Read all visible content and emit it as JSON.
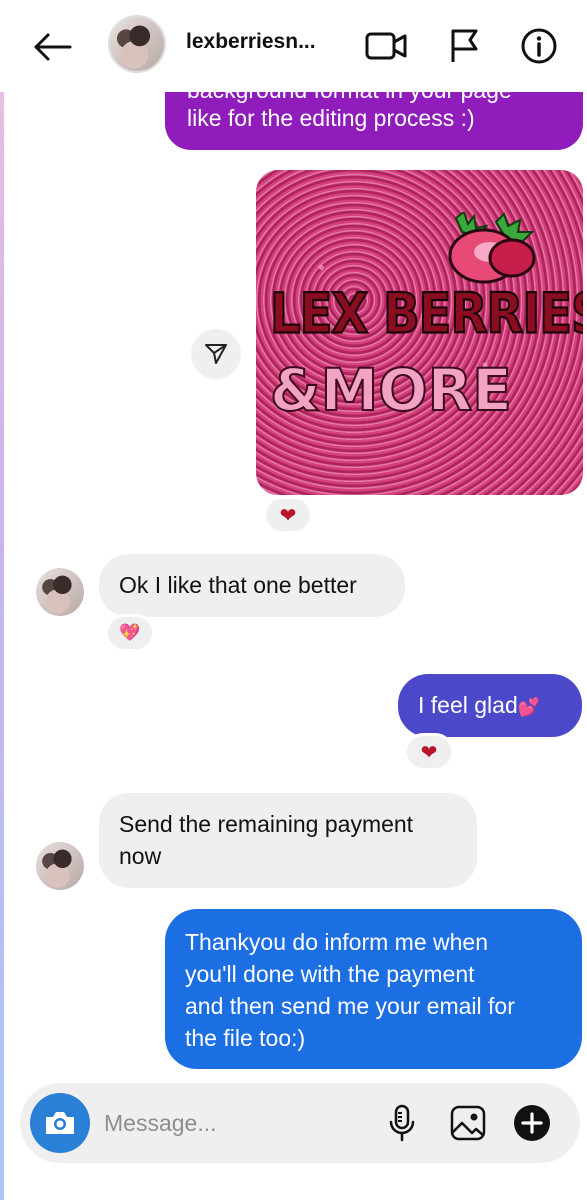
{
  "header": {
    "username": "lexberriesn...",
    "icons": [
      "back-arrow-icon",
      "video-call-icon",
      "flag-icon",
      "info-icon"
    ]
  },
  "messages": [
    {
      "from": "me",
      "text_cut": "background format in your page",
      "text": "like for the editing process :)"
    },
    {
      "from": "me",
      "type": "image",
      "image_text_line1": "LEX BERRIES",
      "image_text_line2": "&MORE",
      "reaction": "❤"
    },
    {
      "from": "them",
      "text": "Ok I like that one better",
      "reaction": "💖"
    },
    {
      "from": "me",
      "text": "I feel glad",
      "emoji": "💕",
      "reaction": "❤"
    },
    {
      "from": "them",
      "text_line1": "Send the remaining payment",
      "text_line2": "now"
    },
    {
      "from": "me",
      "lines": [
        "Thankyou do inform me when",
        "you'll done with the payment",
        "and then send me your email for",
        "the file too:)"
      ]
    }
  ],
  "composer": {
    "placeholder": "Message...",
    "icons": [
      "camera-icon",
      "microphone-icon",
      "gallery-icon",
      "plus-icon"
    ]
  },
  "colors": {
    "bubble_purple": "#8f1cbb",
    "bubble_indigo": "#4b49c9",
    "bubble_blue": "#1c6ee3",
    "bubble_received": "#efefef",
    "camera_button": "#2a7fd6"
  }
}
